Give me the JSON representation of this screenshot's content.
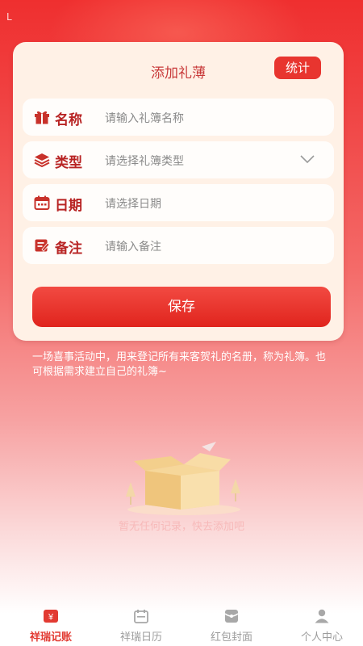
{
  "corner_text": "L",
  "card": {
    "title": "添加礼薄",
    "stat_button": "统计"
  },
  "form": {
    "name": {
      "label": "名称",
      "placeholder": "请输入礼簿名称",
      "icon": "gift-icon"
    },
    "type": {
      "label": "类型",
      "placeholder": "请选择礼簿类型",
      "icon": "layers-icon"
    },
    "date": {
      "label": "日期",
      "placeholder": "请选择日期",
      "icon": "calendar-icon"
    },
    "note": {
      "label": "备注",
      "placeholder": "请输入备注",
      "icon": "note-icon"
    },
    "save_label": "保存"
  },
  "description": "一场喜事活动中，用来登记所有来客贺礼的名册，称为礼簿。也可根据需求建立自己的礼簿~",
  "empty_state": {
    "text": "暂无任何记录，快去添加吧"
  },
  "tabs": [
    {
      "label": "祥瑞记账",
      "icon": "ledger-icon",
      "active": true
    },
    {
      "label": "祥瑞日历",
      "icon": "calendar-icon",
      "active": false
    },
    {
      "label": "红包封面",
      "icon": "envelope-icon",
      "active": false
    },
    {
      "label": "个人中心",
      "icon": "person-icon",
      "active": false
    }
  ],
  "colors": {
    "accent": "#e8352f",
    "label": "#b82424",
    "card_bg": "#fff1e6"
  }
}
